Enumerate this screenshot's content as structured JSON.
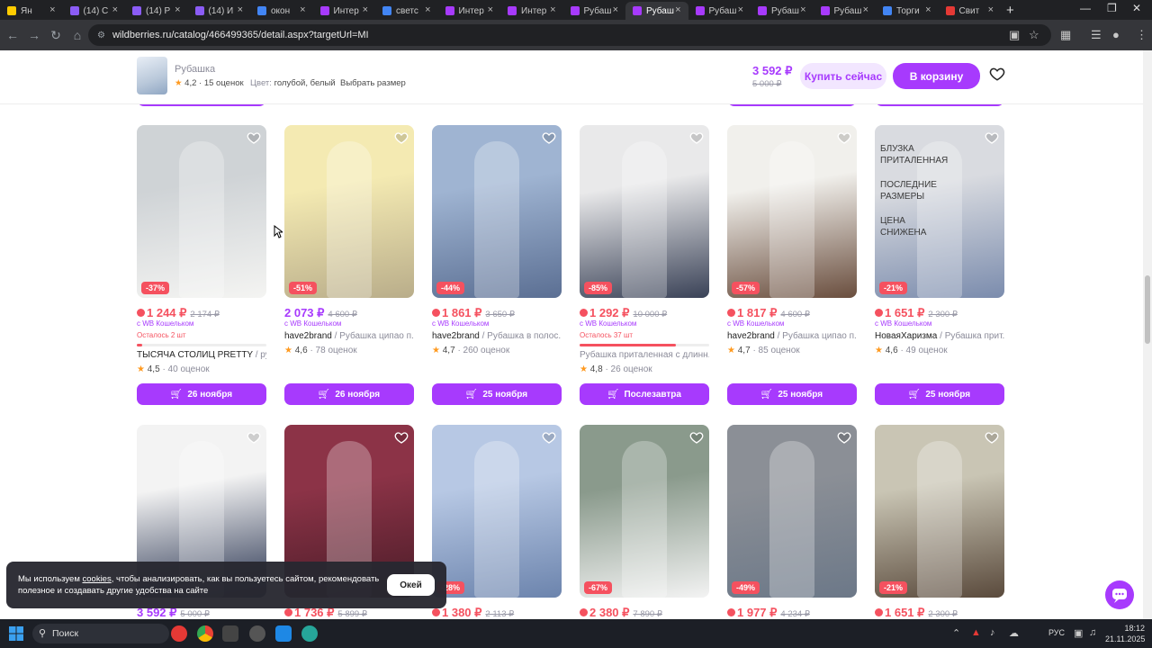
{
  "browser": {
    "tabs": [
      {
        "title": "Ян",
        "color": "#ffcc00"
      },
      {
        "title": "(14) С",
        "color": "#8b5cf6"
      },
      {
        "title": "(14) Р",
        "color": "#8b5cf6"
      },
      {
        "title": "(14) И",
        "color": "#8b5cf6"
      },
      {
        "title": "окон",
        "color": "#4285f4"
      },
      {
        "title": "Интер",
        "color": "#a73afd"
      },
      {
        "title": "светс",
        "color": "#4285f4"
      },
      {
        "title": "Интер",
        "color": "#a73afd"
      },
      {
        "title": "Интер",
        "color": "#a73afd"
      },
      {
        "title": "Рубаш",
        "color": "#a73afd"
      },
      {
        "title": "Рубаш",
        "color": "#a73afd"
      },
      {
        "title": "Рубаш",
        "color": "#a73afd"
      },
      {
        "title": "Рубаш",
        "color": "#a73afd"
      },
      {
        "title": "Рубаш",
        "color": "#a73afd"
      },
      {
        "title": "Торги",
        "color": "#4285f4"
      },
      {
        "title": "Свит",
        "color": "#e53935"
      }
    ],
    "active_tab": 10,
    "url": "wildberries.ru/catalog/466499365/detail.aspx?targetUrl=MI"
  },
  "sticky": {
    "title": "Рубашка",
    "rating": "4,2",
    "reviews": "· 15 оценок",
    "color_label": "Цвет:",
    "color_value": "голубой, белый",
    "size_link": "Выбрать размер",
    "price": "3 592 ₽",
    "old_price": "5 000 ₽",
    "buy_now": "Купить сейчас",
    "to_cart": "В корзину"
  },
  "row1": [
    {
      "discount": "-37%",
      "price": "1 244 ₽",
      "old": "2 174 ₽",
      "wallet": "с WB Кошельком",
      "left": "Осталось 2 шт",
      "left_fill": 0.04,
      "brand": "ТЫСЯЧА СТОЛИЦ PRETTY",
      "name": " / ру...",
      "rating": "4,5",
      "reviews": "· 40 оценок",
      "delivery": "26 ноября",
      "wb_icon": true,
      "price_purple": false,
      "imgA": "#cfd3d6",
      "imgB": "#f4f4f2"
    },
    {
      "discount": "-51%",
      "price": "2 073 ₽",
      "old": "4 600 ₽",
      "wallet": "с WB Кошельком",
      "left": "",
      "left_fill": null,
      "brand": "have2brand",
      "name": " / Рубашка ципао п...",
      "rating": "4,6",
      "reviews": "· 78 оценок",
      "delivery": "26 ноября",
      "wb_icon": false,
      "price_purple": true,
      "imgA": "#f4eab2",
      "imgB": "#b9ad8a"
    },
    {
      "discount": "-44%",
      "price": "1 861 ₽",
      "old": "3 650 ₽",
      "wallet": "с WB Кошельком",
      "left": "",
      "left_fill": null,
      "brand": "have2brand",
      "name": " / Рубашка в полос...",
      "rating": "4,7",
      "reviews": "· 260 оценок",
      "delivery": "25 ноября",
      "wb_icon": true,
      "price_purple": false,
      "imgA": "#9fb4d2",
      "imgB": "#5b6f93"
    },
    {
      "discount": "-85%",
      "price": "1 292 ₽",
      "old": "10 000 ₽",
      "wallet": "с WB Кошельком",
      "left": "Осталось 37 шт",
      "left_fill": 0.74,
      "brand": "",
      "name": "Рубашка приталенная с длинн...",
      "rating": "4,8",
      "reviews": "· 26 оценок",
      "delivery": "Послезавтра",
      "wb_icon": true,
      "price_purple": false,
      "imgA": "#e9e9ea",
      "imgB": "#3a4257"
    },
    {
      "discount": "-57%",
      "price": "1 817 ₽",
      "old": "4 600 ₽",
      "wallet": "с WB Кошельком",
      "left": "",
      "left_fill": null,
      "brand": "have2brand",
      "name": " / Рубашка ципао п...",
      "rating": "4,7",
      "reviews": "· 85 оценок",
      "delivery": "25 ноября",
      "wb_icon": true,
      "price_purple": false,
      "imgA": "#f1f0ec",
      "imgB": "#6a4e3e"
    },
    {
      "discount": "-21%",
      "price": "1 651 ₽",
      "old": "2 300 ₽",
      "wallet": "с WB Кошельком",
      "left": "",
      "left_fill": null,
      "brand": "НоваяХаризма",
      "name": " / Рубашка прит...",
      "rating": "4,6",
      "reviews": "· 49 оценок",
      "delivery": "25 ноября",
      "wb_icon": true,
      "price_purple": false,
      "imgA": "#d9dbe0",
      "imgB": "#7b8cad",
      "overlay": [
        "БЛУЗКА",
        "ПРИТАЛЕННАЯ",
        "ПОСЛЕДНИЕ",
        "РАЗМЕРЫ",
        "ЦЕНА",
        "СНИЖЕНА"
      ]
    }
  ],
  "row2": [
    {
      "discount": "",
      "price": "3 592 ₽",
      "old": "5 000 ₽",
      "wb_icon": false,
      "price_purple": true,
      "imgA": "#f3f3f3",
      "imgB": "#27324f"
    },
    {
      "discount": "",
      "price": "1 736 ₽",
      "old": "5 899 ₽",
      "wb_icon": true,
      "price_purple": false,
      "imgA": "#8c3347",
      "imgB": "#4a1c28"
    },
    {
      "discount": "-28%",
      "price": "1 380 ₽",
      "old": "2 113 ₽",
      "wb_icon": true,
      "price_purple": false,
      "imgA": "#b7c8e4",
      "imgB": "#6c84ad"
    },
    {
      "discount": "-67%",
      "price": "2 380 ₽",
      "old": "7 890 ₽",
      "wb_icon": true,
      "price_purple": false,
      "imgA": "#8a9a8c",
      "imgB": "#f3f3f3"
    },
    {
      "discount": "-49%",
      "price": "1 977 ₽",
      "old": "4 234 ₽",
      "wb_icon": true,
      "price_purple": false,
      "imgA": "#8b8f96",
      "imgB": "#6c7888"
    },
    {
      "discount": "-21%",
      "price": "1 651 ₽",
      "old": "2 300 ₽",
      "wb_icon": true,
      "price_purple": false,
      "imgA": "#c9c5b4",
      "imgB": "#5a4a3c"
    }
  ],
  "cookie": {
    "text_before": "Мы используем ",
    "link": "cookies",
    "text_after": ", чтобы анализировать, как вы пользуетесь сайтом, рекомендовать полезное и создавать другие удобства на сайте",
    "ok": "Окей"
  },
  "taskbar": {
    "search": "Поиск",
    "lang": "РУС",
    "time": "18:12",
    "date": "21.11.2025"
  },
  "colors": {
    "accent": "#a73afd",
    "sale": "#f5515f",
    "star": "#ff9a1f"
  }
}
